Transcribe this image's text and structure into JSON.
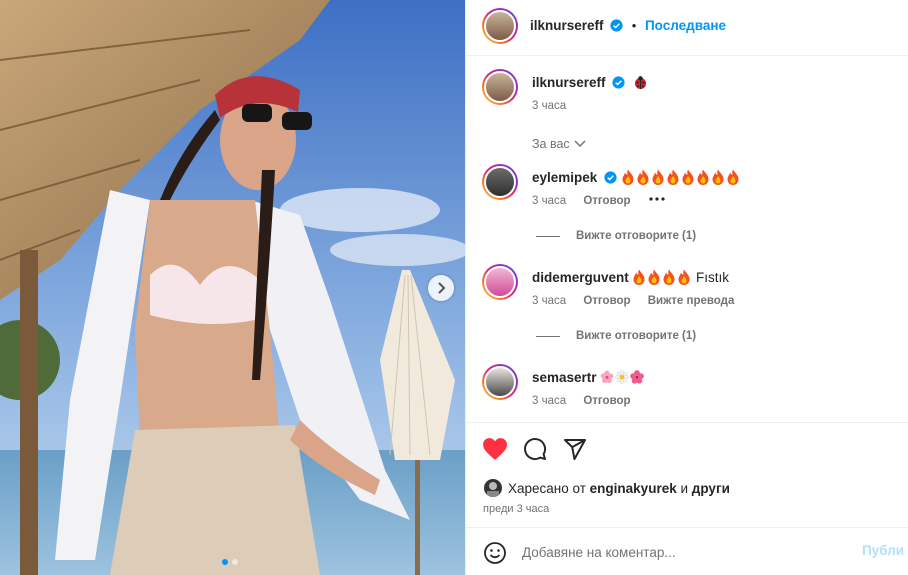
{
  "header": {
    "username": "ilknursereff",
    "follow_label": "Последване",
    "bullet": "•"
  },
  "caption": {
    "username": "ilknursereff",
    "time": "3 часа"
  },
  "for_you_label": "За вас",
  "comments": [
    {
      "username": "eylemipek",
      "verified": true,
      "emoji": [
        "fire",
        "fire",
        "fire",
        "fire",
        "fire",
        "fire",
        "fire",
        "fire"
      ],
      "text": "",
      "time": "3 часа",
      "reply_label": "Отговор",
      "translate_label": "",
      "view_replies": "Вижте отговорите (1)"
    },
    {
      "username": "didemerguvent",
      "verified": false,
      "emoji": [
        "fire",
        "fire",
        "fire",
        "fire"
      ],
      "text": "Fıstık",
      "time": "3 часа",
      "reply_label": "Отговор",
      "translate_label": "Вижте превода",
      "view_replies": "Вижте отговорите (1)"
    },
    {
      "username": "semasertr",
      "verified": false,
      "emoji": [
        "cherry-blossom",
        "daisy",
        "hibiscus"
      ],
      "text": "",
      "time": "3 часа",
      "reply_label": "Отговор",
      "translate_label": "",
      "view_replies": ""
    }
  ],
  "likes": {
    "prefix": "Харесано от",
    "user": "enginakyurek",
    "conj": "и",
    "others": "други"
  },
  "post_time": "преди 3 часа",
  "add_comment": {
    "placeholder": "Добавяне на коментар...",
    "post_label": "Публи"
  },
  "carousel": {
    "current": 1,
    "total": 2
  },
  "colors": {
    "accent": "#0095f6",
    "like": "#ff3040",
    "muted": "#737373"
  },
  "icons": [
    "verified-icon",
    "ladybug-icon",
    "heart-icon",
    "comment-icon",
    "share-icon",
    "emoji-icon",
    "chevron-right-icon",
    "chevron-down-icon",
    "more-icon"
  ]
}
